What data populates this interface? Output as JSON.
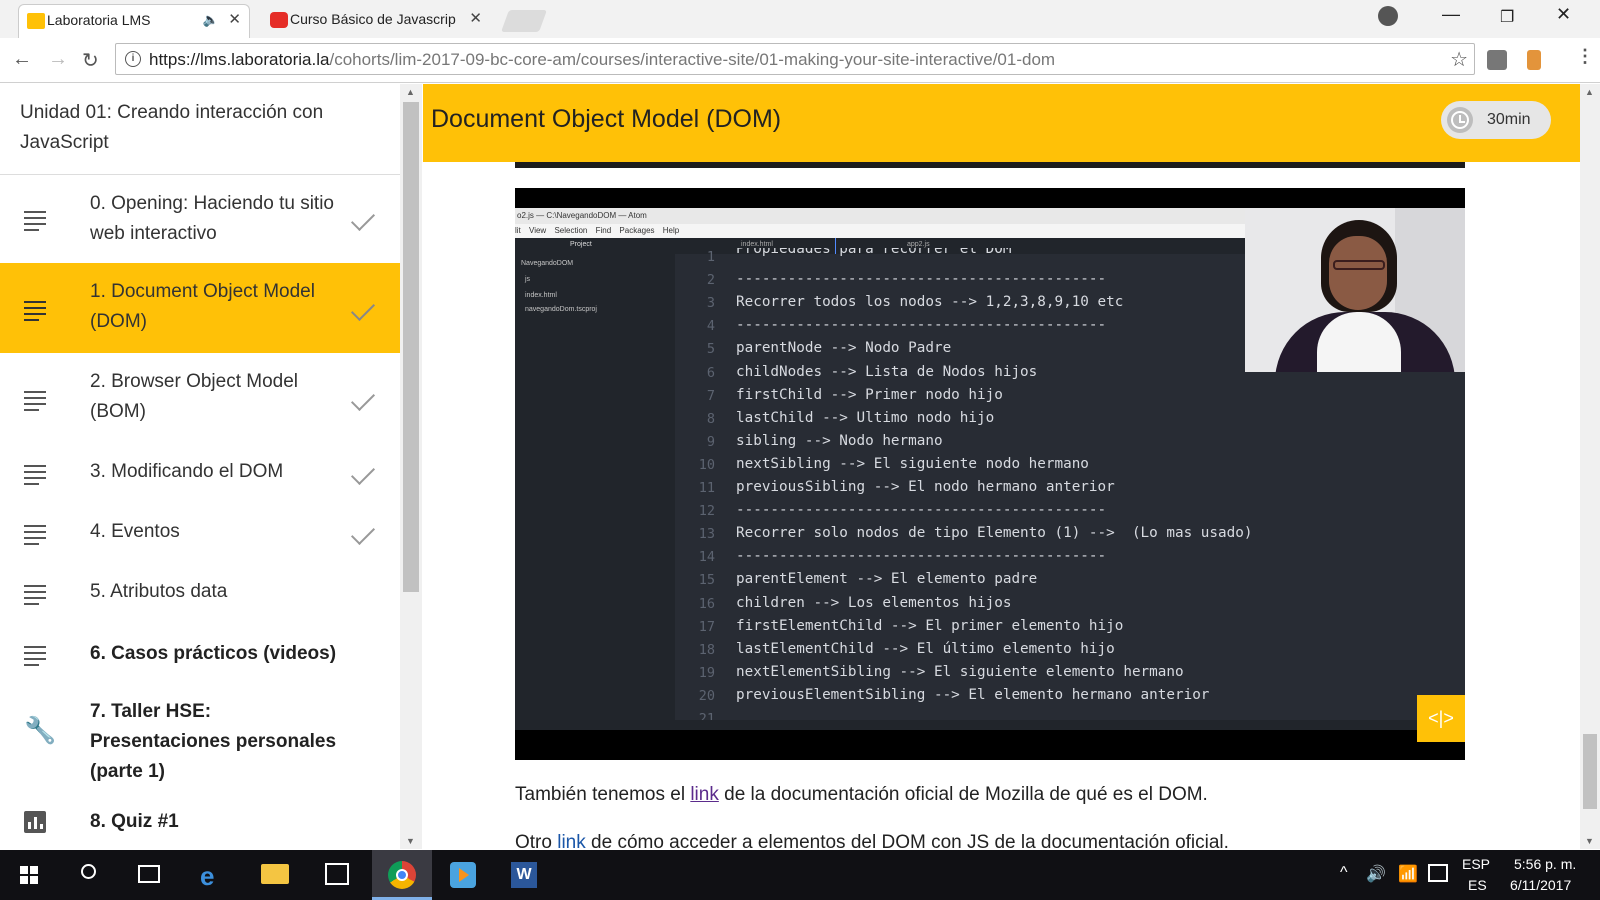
{
  "browser": {
    "tabs": [
      {
        "title": "Laboratoria LMS",
        "active": true,
        "favicon_color": "#ffc107"
      },
      {
        "title": "Curso Básico de Javascrip",
        "active": false,
        "favicon_color": "#e52d27"
      }
    ],
    "url_host": "https://lms.laboratoria.la",
    "url_path": "/cohorts/lim-2017-09-bc-core-am/courses/interactive-site/01-making-your-site-interactive/01-dom"
  },
  "sidebar": {
    "unit_title": "Unidad 01: Creando interacción con JavaScript",
    "items": [
      {
        "label": "0. Opening: Haciendo tu sitio web interactivo",
        "icon": "lines-icon",
        "done": true,
        "active": false,
        "bold": false
      },
      {
        "label": "1. Document Object Model (DOM)",
        "icon": "lines-icon",
        "done": true,
        "active": true,
        "bold": false
      },
      {
        "label": "2. Browser Object Model (BOM)",
        "icon": "lines-icon",
        "done": true,
        "active": false,
        "bold": false
      },
      {
        "label": "3. Modificando el DOM",
        "icon": "lines-icon",
        "done": true,
        "active": false,
        "bold": false
      },
      {
        "label": "4. Eventos",
        "icon": "lines-icon",
        "done": true,
        "active": false,
        "bold": false
      },
      {
        "label": "5. Atributos data",
        "icon": "lines-icon",
        "done": false,
        "active": false,
        "bold": false
      },
      {
        "label": "6. Casos prácticos (videos)",
        "icon": "lines-icon",
        "done": false,
        "active": false,
        "bold": true
      },
      {
        "label": "7. Taller HSE: Presentaciones personales (parte 1)",
        "icon": "wrench-icon",
        "done": false,
        "active": false,
        "bold": true
      },
      {
        "label": "8. Quiz #1",
        "icon": "chart-icon",
        "done": false,
        "active": false,
        "bold": true
      }
    ]
  },
  "main": {
    "title": "Document Object Model (DOM)",
    "duration": "30min",
    "paragraph1": {
      "before": "También tenemos el ",
      "link": "link",
      "after": " de la documentación oficial de Mozilla de qué es el DOM."
    },
    "paragraph2": {
      "before": "Otro ",
      "link": "link",
      "after": " de cómo acceder a elementos del DOM con JS de la documentación oficial."
    }
  },
  "video": {
    "editor_title": "o2.js — C:\\NavegandoDOM — Atom",
    "menu": [
      "lit",
      "View",
      "Selection",
      "Find",
      "Packages",
      "Help"
    ],
    "tree_header": "Project",
    "tree_items": [
      "NavegandoDOM",
      "js",
      "index.html",
      "navegandoDom.tscproj"
    ],
    "editor_tabs": [
      "index.html",
      "app2.js"
    ],
    "corner_logo": "<|>",
    "code_lines": [
      {
        "n": "1",
        "text": "Propiedades para recorrer el DOM"
      },
      {
        "n": "2",
        "text": "-------------------------------------------"
      },
      {
        "n": "3",
        "text": "Recorrer todos los nodos --> 1,2,3,8,9,10 etc"
      },
      {
        "n": "4",
        "text": "-------------------------------------------"
      },
      {
        "n": "5",
        "text": "parentNode --> Nodo Padre"
      },
      {
        "n": "6",
        "text": "childNodes --> Lista de Nodos hijos"
      },
      {
        "n": "7",
        "text": "firstChild --> Primer nodo hijo"
      },
      {
        "n": "8",
        "text": "lastChild --> Ultimo nodo hijo"
      },
      {
        "n": "9",
        "text": "sibling --> Nodo hermano"
      },
      {
        "n": "10",
        "text": "nextSibling --> El siguiente nodo hermano"
      },
      {
        "n": "11",
        "text": "previousSibling --> El nodo hermano anterior"
      },
      {
        "n": "12",
        "text": "-------------------------------------------"
      },
      {
        "n": "13",
        "text": "Recorrer solo nodos de tipo Elemento (1) -->  (Lo mas usado)"
      },
      {
        "n": "14",
        "text": "-------------------------------------------"
      },
      {
        "n": "15",
        "text": "parentElement --> El elemento padre"
      },
      {
        "n": "16",
        "text": "children --> Los elementos hijos"
      },
      {
        "n": "17",
        "text": "firstElementChild --> El primer elemento hijo"
      },
      {
        "n": "18",
        "text": "lastElementChild --> El último elemento hijo"
      },
      {
        "n": "19",
        "text": "nextElementSibling --> El siguiente elemento hermano"
      },
      {
        "n": "20",
        "text": "previousElementSibling --> El elemento hermano anterior"
      },
      {
        "n": "21",
        "text": ""
      }
    ]
  },
  "taskbar": {
    "lang_top": "ESP",
    "lang_bottom": "ES",
    "time": "5:56 p. m.",
    "date": "6/11/2017"
  },
  "colors": {
    "accent": "#ffc107",
    "editor_bg": "#282c34",
    "link": "#5b2b8c"
  }
}
